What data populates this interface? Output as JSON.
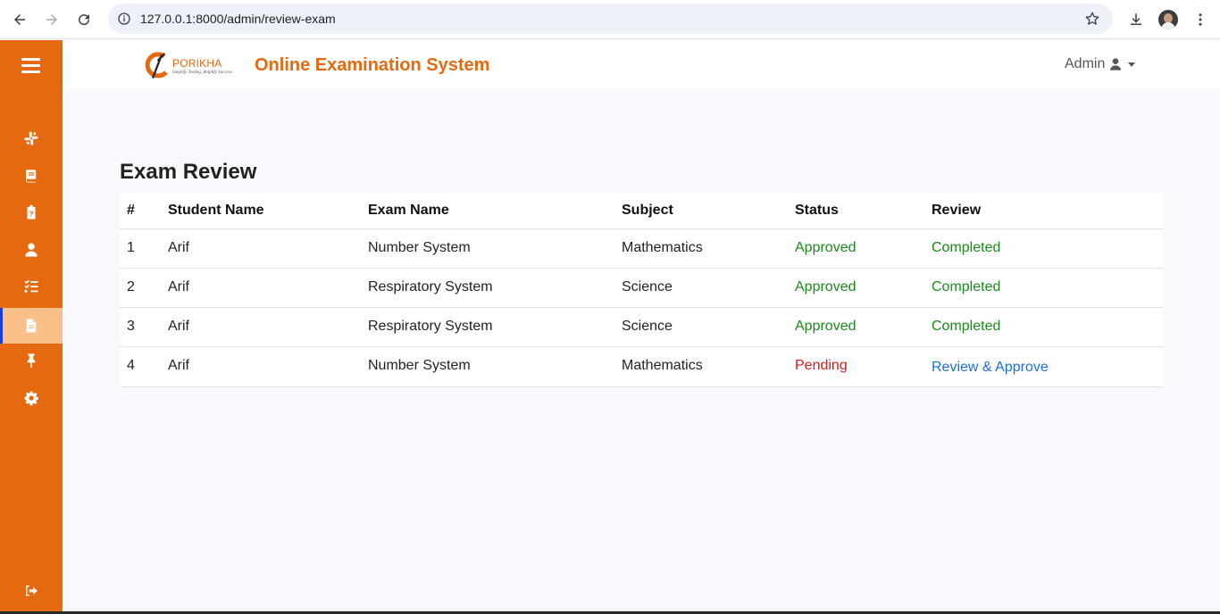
{
  "browser": {
    "url": "127.0.0.1:8000/admin/review-exam",
    "icons": [
      "back-arrow-icon",
      "forward-arrow-icon",
      "reload-icon",
      "info-icon",
      "star-icon",
      "download-icon",
      "profile-avatar",
      "kebab-menu-icon"
    ]
  },
  "sidebar": {
    "colors": {
      "background": "#e5690f",
      "active": "#fbbf8a",
      "active_indicator": "#1a3dd6"
    },
    "items": [
      {
        "icon": "slack-icon"
      },
      {
        "icon": "book-icon"
      },
      {
        "icon": "clipboard-question-icon"
      },
      {
        "icon": "user-icon"
      },
      {
        "icon": "list-check-icon"
      },
      {
        "icon": "file-icon",
        "active": true
      },
      {
        "icon": "thumbtack-icon"
      },
      {
        "icon": "gear-icon"
      }
    ],
    "logout_icon": "sign-out-icon"
  },
  "header": {
    "logo_text": "PORIKHA",
    "logo_tagline": "Simplify Testing, Amplify Success",
    "title": "Online Examination System",
    "user_label": "Admin"
  },
  "page": {
    "title": "Exam Review"
  },
  "table": {
    "headers": [
      "#",
      "Student Name",
      "Exam Name",
      "Subject",
      "Status",
      "Review"
    ],
    "rows": [
      {
        "num": "1",
        "student": "Arif",
        "exam": "Number System",
        "subject": "Mathematics",
        "status": "Approved",
        "review": "Completed"
      },
      {
        "num": "2",
        "student": "Arif",
        "exam": "Respiratory System",
        "subject": "Science",
        "status": "Approved",
        "review": "Completed"
      },
      {
        "num": "3",
        "student": "Arif",
        "exam": "Respiratory System",
        "subject": "Science",
        "status": "Approved",
        "review": "Completed"
      },
      {
        "num": "4",
        "student": "Arif",
        "exam": "Number System",
        "subject": "Mathematics",
        "status": "Pending",
        "review": "Review & Approve"
      }
    ],
    "colors": {
      "approved": "#1a8a1a",
      "pending": "#d41a1a",
      "link": "#1a6fd8"
    }
  }
}
